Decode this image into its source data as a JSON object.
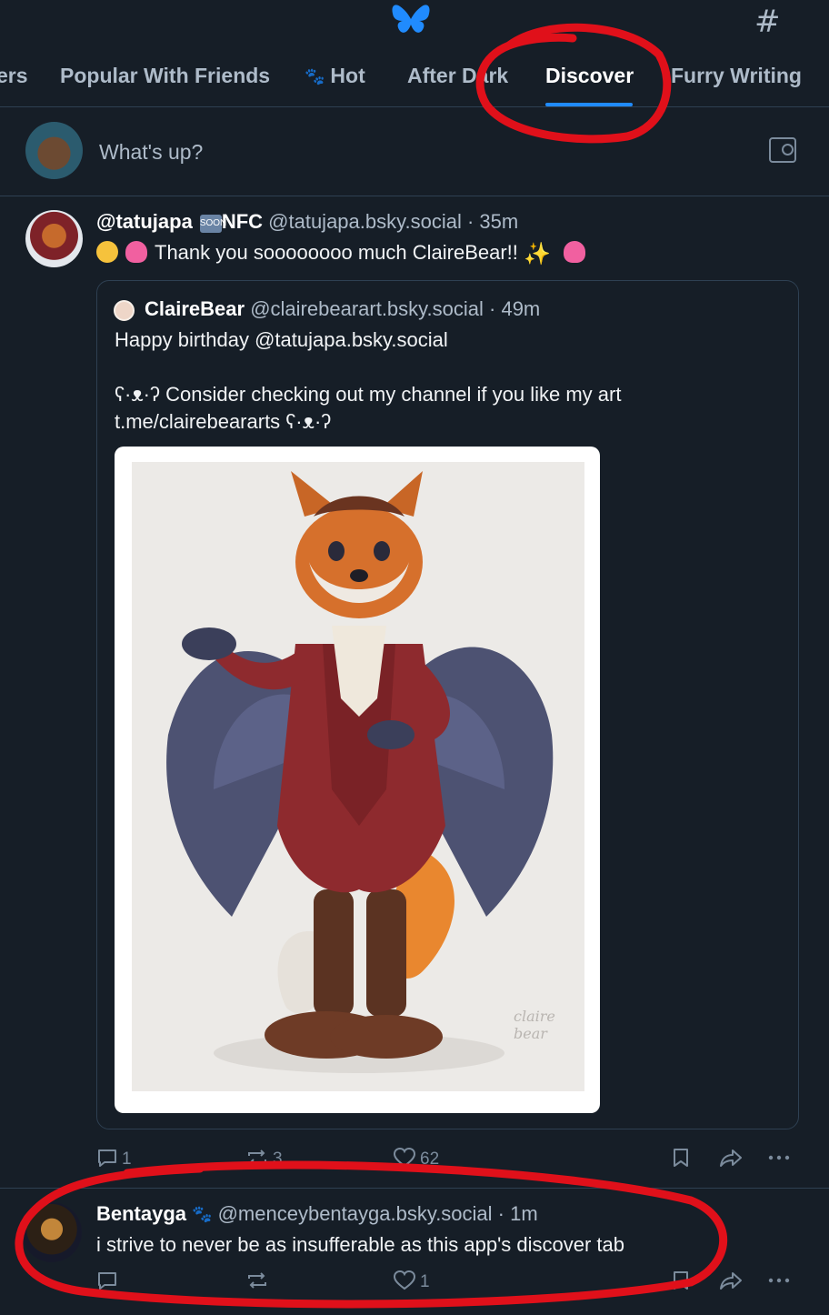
{
  "header": {
    "tabs": [
      {
        "label": "ers",
        "active": false
      },
      {
        "label": "Popular With Friends",
        "active": false
      },
      {
        "label": "Hot",
        "active": false,
        "icon": "paw-icon"
      },
      {
        "label": "After Dark",
        "active": false
      },
      {
        "label": "Discover",
        "active": true
      },
      {
        "label": "Furry Writing",
        "active": false
      }
    ],
    "hash_label": "#"
  },
  "composer": {
    "placeholder": "What's up?"
  },
  "posts": [
    {
      "author_name": "@tatujapa",
      "soon_badge": "SOON",
      "author_suffix": "NFC",
      "handle": "@tatujapa.bsky.social",
      "time": "35m",
      "text": "Thank you soooooooo much ClaireBear!!",
      "quote": {
        "author_name": "ClaireBear",
        "handle": "@clairebearart.bsky.social",
        "time": "49m",
        "lines": [
          "Happy birthday @tatujapa.bsky.social",
          "ʕ·ᴥ·ʔ Consider checking out my channel if you like my art",
          "t.me/clairebeararts ʕ·ᴥ·ʔ"
        ],
        "signature": "claire bear"
      },
      "counts": {
        "replies": "1",
        "reposts": "3",
        "likes": "62"
      }
    },
    {
      "author_name": "Bentayga",
      "handle": "@menceybentayga.bsky.social",
      "time": "1m",
      "text": "i strive to never be as insufferable as this app's discover tab",
      "counts": {
        "replies": "",
        "reposts": "",
        "likes": "1"
      }
    }
  ],
  "colors": {
    "background": "#161e27",
    "accent": "#208bfe",
    "annotation": "#e0101a"
  }
}
